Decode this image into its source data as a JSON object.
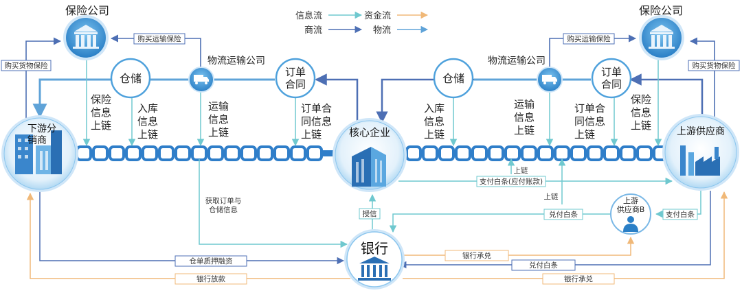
{
  "legend": {
    "info_flow": "信息流",
    "capital_flow": "资金流",
    "business_flow": "商流",
    "logistics_flow": "物流",
    "colors": {
      "info": "#6fc8cf",
      "capital": "#f3c690",
      "business": "#4d6fb4",
      "logistics": "#5fa3d8"
    }
  },
  "nodes": {
    "insurer_left": "保险公司",
    "insurer_right": "保险公司",
    "warehouse_left": "仓储",
    "warehouse_right": "仓储",
    "logistics_left": "物流运输公司",
    "logistics_right": "物流运输公司",
    "order_left": [
      "订单",
      "合同"
    ],
    "order_right": [
      "订单",
      "合同"
    ],
    "downstream": [
      "下游分",
      "销商"
    ],
    "core": "核心企业",
    "upstream": "上游供应商",
    "upstream_b": [
      "上游",
      "供应商B"
    ],
    "bank": "银行"
  },
  "chain_labels": {
    "insurance_left": [
      "保险",
      "信息",
      "上链"
    ],
    "inbound_left": [
      "入库",
      "信息",
      "上链"
    ],
    "transport_left": [
      "运输",
      "信息",
      "上链"
    ],
    "order_left": [
      "订单合",
      "同信息",
      "上链"
    ],
    "inbound_right": [
      "入库",
      "信息",
      "上链"
    ],
    "transport_right": [
      "运输",
      "信息",
      "上链"
    ],
    "order_right": [
      "订单合",
      "同信息",
      "上链"
    ],
    "insurance_right": [
      "保险",
      "信息",
      "上链"
    ]
  },
  "edge_labels": {
    "buy_transport_ins_left": "购买运输保险",
    "buy_goods_ins_left": "购买货物保险",
    "buy_transport_ins_right": "购买运输保险",
    "buy_goods_ins_right": "购买货物保险",
    "get_order": [
      "获取订单与",
      "仓储信息"
    ],
    "credit": "授信",
    "chain_up_1": "上链",
    "pay_iou": "支付白条(应付账款)",
    "chain_up_2": "上链",
    "redeem_iou_1": "兑付白条",
    "pay_iou_b": "支付白条",
    "bank_accept_1": "银行承兑",
    "redeem_iou_2": "兑付白条",
    "warehouse_pledge": "仓单质押融资",
    "bank_loan": "银行放款",
    "bank_accept_2": "银行承兑"
  }
}
